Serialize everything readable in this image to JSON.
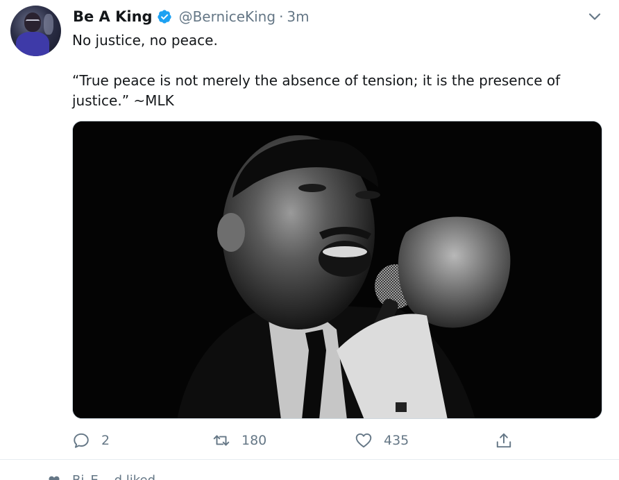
{
  "tweet": {
    "display_name": "Be A King",
    "handle": "@BerniceKing",
    "separator": "·",
    "time": "3m",
    "text_line1": "No justice, no peace.",
    "text_line2": "“True peace is not merely the absence of tension; it is the presence of justice.” ~MLK",
    "verified": true,
    "accent_color": "#1da1f2",
    "text_color": "#14171a",
    "muted_color": "#657786"
  },
  "actions": {
    "reply_count": "2",
    "retweet_count": "180",
    "like_count": "435"
  },
  "icons": {
    "caret": "chevron-down-icon",
    "reply": "reply-icon",
    "retweet": "retweet-icon",
    "like": "heart-icon",
    "share": "share-icon",
    "verified": "verified-badge-icon"
  },
  "footer": {
    "liked_text": "Bi_E... d liked"
  }
}
